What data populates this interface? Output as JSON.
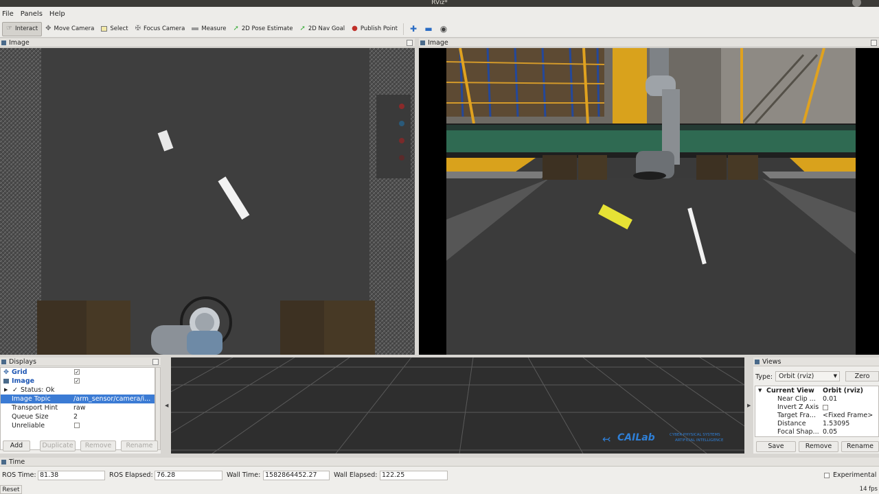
{
  "window": {
    "title": "RViz*"
  },
  "menu": [
    "File",
    "Panels",
    "Help"
  ],
  "toolbar": {
    "tools": [
      {
        "label": "Interact",
        "icon": "interact-icon",
        "active": true
      },
      {
        "label": "Move Camera",
        "icon": "move-camera-icon"
      },
      {
        "label": "Select",
        "icon": "select-icon"
      },
      {
        "label": "Focus Camera",
        "icon": "focus-camera-icon"
      },
      {
        "label": "Measure",
        "icon": "measure-icon"
      },
      {
        "label": "2D Pose Estimate",
        "icon": "pose-estimate-icon"
      },
      {
        "label": "2D Nav Goal",
        "icon": "nav-goal-icon"
      },
      {
        "label": "Publish Point",
        "icon": "publish-point-icon"
      }
    ]
  },
  "image_panels": [
    {
      "title": "Image"
    },
    {
      "title": "Image"
    }
  ],
  "displays": {
    "title": "Displays",
    "rows": [
      {
        "label": "Grid",
        "checked": true
      },
      {
        "label": "Image",
        "checked": true
      },
      {
        "label": "Status: Ok"
      },
      {
        "label": "Image Topic",
        "value": "/arm_sensor/camera/i..."
      },
      {
        "label": "Transport Hint",
        "value": "raw"
      },
      {
        "label": "Queue Size",
        "value": "2"
      },
      {
        "label": "Unreliable",
        "checked": false
      }
    ],
    "buttons": [
      "Add",
      "Duplicate",
      "Remove",
      "Rename"
    ]
  },
  "watermark": {
    "logo": "CAILab",
    "line1": "CYBER-PHYSICAL SYSTEMS",
    "line2": "ARTIFICIAL INTELLIGENCE"
  },
  "views": {
    "title": "Views",
    "type_label": "Type:",
    "type_value": "Orbit (rviz)",
    "zero_label": "Zero",
    "current_view": {
      "label": "Current View",
      "value": "Orbit (rviz)"
    },
    "props": [
      {
        "label": "Near Clip ...",
        "value": "0.01"
      },
      {
        "label": "Invert Z Axis",
        "value": ""
      },
      {
        "label": "Target Fra...",
        "value": "<Fixed Frame>"
      },
      {
        "label": "Distance",
        "value": "1.53095"
      },
      {
        "label": "Focal Shap...",
        "value": "0.05"
      }
    ],
    "buttons": [
      "Save",
      "Remove",
      "Rename"
    ]
  },
  "time": {
    "title": "Time",
    "ros_time_label": "ROS Time:",
    "ros_time": "81.38",
    "ros_elapsed_label": "ROS Elapsed:",
    "ros_elapsed": "76.28",
    "wall_time_label": "Wall Time:",
    "wall_time": "1582864452.27",
    "wall_elapsed_label": "Wall Elapsed:",
    "wall_elapsed": "122.25",
    "experimental_label": "Experimental",
    "reset_label": "Reset",
    "fps": "14 fps"
  },
  "colors": {
    "selection": "#3b7bd4",
    "display_label": "#1c55b3"
  }
}
